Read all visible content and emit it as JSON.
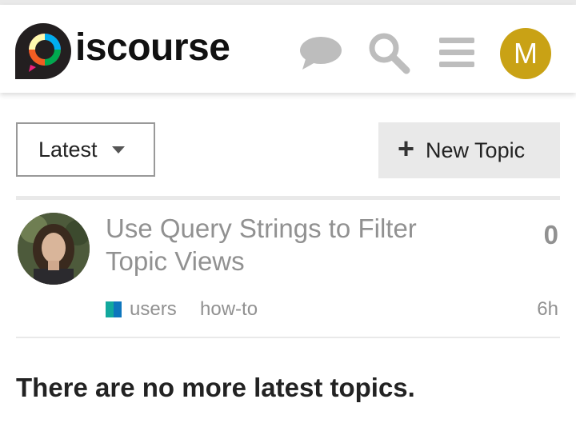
{
  "app": {
    "logo_text": "iscourse"
  },
  "header": {
    "icons": [
      "chat-icon",
      "search-icon",
      "hamburger-menu-icon"
    ],
    "avatar_initial": "M",
    "avatar_color": "#c9a215"
  },
  "nav": {
    "latest_label": "Latest",
    "new_topic_label": "New Topic"
  },
  "topics": [
    {
      "title": "Use Query Strings to Filter Topic Views",
      "replies": "0",
      "category": "users",
      "category_colors": [
        "#12a89d",
        "#0e76bd"
      ],
      "tag": "how-to",
      "age": "6h"
    }
  ],
  "footer": {
    "message": "There are no more latest topics."
  }
}
